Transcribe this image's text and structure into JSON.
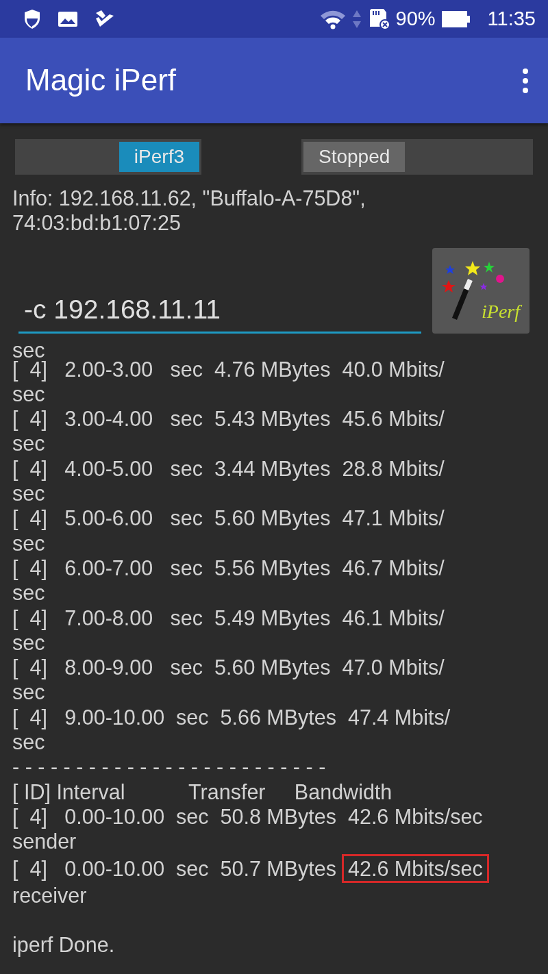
{
  "status_bar": {
    "battery_percent": "90%",
    "time": "11:35"
  },
  "app_bar": {
    "title": "Magic iPerf"
  },
  "switches": [
    {
      "label": "iPerf3",
      "on": true
    },
    {
      "label": "Stopped",
      "on": false
    }
  ],
  "info": {
    "text": "Info: 192.168.11.62, \"Buffalo-A-75D8\", 74:03:bd:b1:07:25"
  },
  "command": {
    "value": "-c 192.168.11.11"
  },
  "run_button": {
    "logo_text": "iPerf"
  },
  "output": [
    {
      "text": "sec"
    },
    {
      "text": "[  4]   2.00-3.00   sec  4.76 MBytes  40.0 Mbits/"
    },
    {
      "text": "sec"
    },
    {
      "text": "[  4]   3.00-4.00   sec  5.43 MBytes  45.6 Mbits/"
    },
    {
      "text": "sec"
    },
    {
      "text": "[  4]   4.00-5.00   sec  3.44 MBytes  28.8 Mbits/"
    },
    {
      "text": "sec"
    },
    {
      "text": "[  4]   5.00-6.00   sec  5.60 MBytes  47.1 Mbits/"
    },
    {
      "text": "sec"
    },
    {
      "text": "[  4]   6.00-7.00   sec  5.56 MBytes  46.7 Mbits/"
    },
    {
      "text": "sec"
    },
    {
      "text": "[  4]   7.00-8.00   sec  5.49 MBytes  46.1 Mbits/"
    },
    {
      "text": "sec"
    },
    {
      "text": "[  4]   8.00-9.00   sec  5.60 MBytes  47.0 Mbits/"
    },
    {
      "text": "sec"
    },
    {
      "text": "[  4]   9.00-10.00  sec  5.66 MBytes  47.4 Mbits/"
    },
    {
      "text": "sec"
    },
    {
      "text": "- - - - - - - - - - - - - - - - - - - - - - - - -"
    },
    {
      "text": "[ ID] Interval           Transfer     Bandwidth"
    },
    {
      "text": "[  4]   0.00-10.00  sec  50.8 MBytes  42.6 Mbits/sec"
    },
    {
      "text": "sender"
    },
    {
      "text": "[  4]   0.00-10.00  sec  50.7 MBytes",
      "highlight": "42.6 Mbits/sec"
    },
    {
      "text": "receiver"
    },
    {
      "kind": "blank"
    },
    {
      "text": "iperf Done."
    }
  ]
}
